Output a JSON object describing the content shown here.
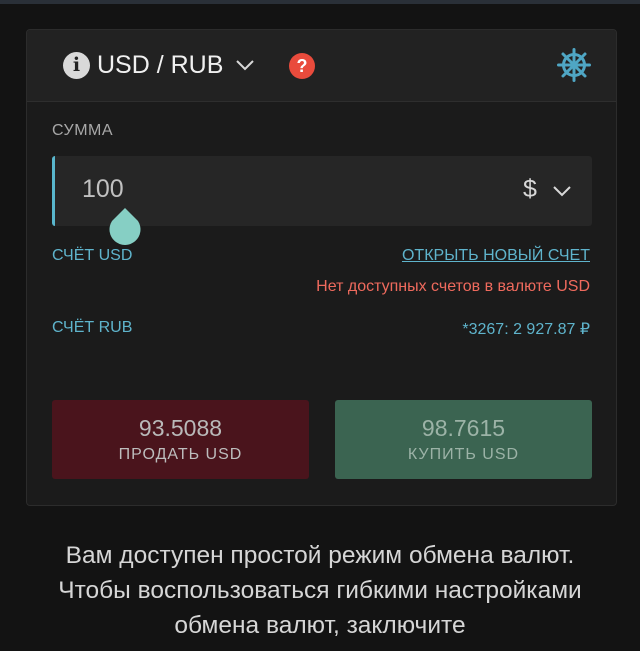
{
  "header": {
    "currency_pair": "USD / RUB",
    "info_glyph": "i",
    "help_glyph": "?",
    "icons": [
      "info-icon",
      "chevron-down-icon",
      "help-icon",
      "helm-icon"
    ]
  },
  "amount": {
    "label": "СУММА",
    "value": "100",
    "currency_symbol": "$"
  },
  "accounts": {
    "usd_label": "СЧЁТ USD",
    "open_new_link": "ОТКРЫТЬ НОВЫЙ СЧЕТ",
    "no_accounts_message": "Нет доступных счетов в валюте USD",
    "rub_label": "СЧЁТ RUB",
    "rub_value": "*3267: 2 927.87 ₽"
  },
  "trade": {
    "sell_price": "93.5088",
    "sell_label": "ПРОДАТЬ USD",
    "buy_price": "98.7615",
    "buy_label": "КУПИТЬ USD"
  },
  "notice": {
    "line1": "Вам доступен простой режим обмена валют.",
    "line2": "Чтобы воспользоваться гибкими настройками",
    "line3": "обмена валют, заключите"
  },
  "colors": {
    "accent": "#5fb4cc",
    "error": "#ef6a5d",
    "sell": "#4a141c",
    "buy": "#3b6451",
    "help": "#e94b3c"
  }
}
